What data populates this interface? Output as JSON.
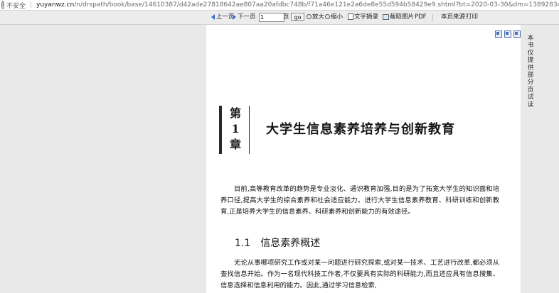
{
  "browser": {
    "security_label": "不安全",
    "url_host": "yuyanwz.cn",
    "url_path": "/n/drspath/book/base/14610387/d42ade27818642ae807aa20afdbc748b/f71a46e121e2a6de8e55d594b58429e9.shtml?bt=2020-03-30&dm=1389283459&et=2020-0"
  },
  "toolbar": {
    "prev_page": "上一页",
    "next_page": "下一页",
    "page_value": "1",
    "page_unit": "页",
    "go_label": "go",
    "zoom_in": "放大",
    "zoom_out": "缩小",
    "text_extract": "文字摘录",
    "capture_image": "截取图片",
    "pdf": "PDF",
    "page_source": "本页来源",
    "print": "打印"
  },
  "sidebar": {
    "vertical_text": [
      "本",
      "书",
      "仅",
      "提",
      "供",
      "部",
      "分",
      "页",
      "试",
      "读"
    ]
  },
  "document": {
    "chapter_chars": [
      "第",
      "1",
      "章"
    ],
    "chapter_title": "大学生信息素养培养与创新教育",
    "paragraph1": "目前,高等教育改革的趋势是专业淡化、通识教育加强,目的是为了拓宽大学生的知识面和培养口径,提高大学生的综合素养和社会适应能力。进行大学生信息素养教育、科研训练和创新教育,正是培养大学生的信息素养、科研素养和创新能力的有效途径。",
    "section_number": "1.1",
    "section_title": "信息素养概述",
    "paragraph2": "无论从事哪项研究工作或对某一问题进行研究探索,或对某一技术、工艺进行改革,都必须从查找信息开始。作为一名现代科技工作者,不仅要具有实际的科研能力,而且还应具有信息搜集、信息选择和信息利用的能力。因此,通过学习信息检索,"
  }
}
